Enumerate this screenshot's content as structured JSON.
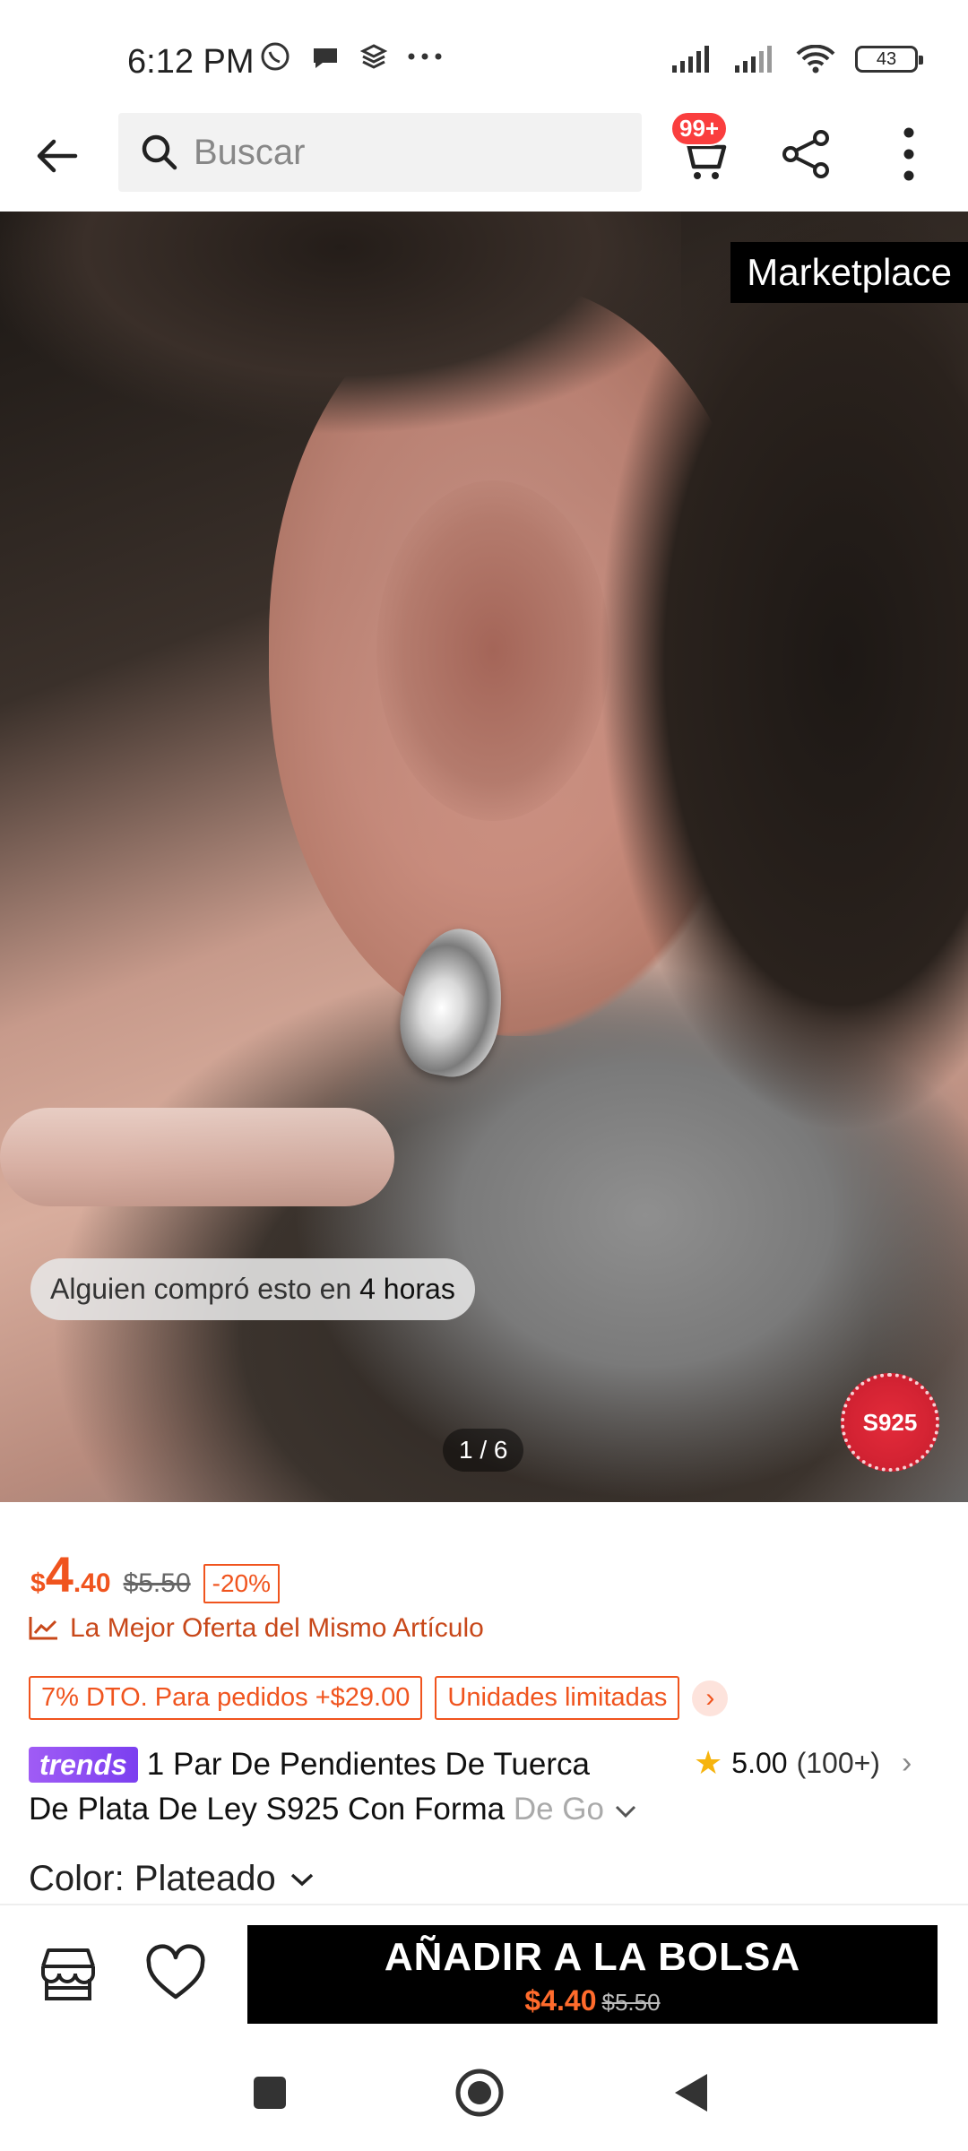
{
  "status_bar": {
    "time": "6:12 PM",
    "battery": "43",
    "icons": [
      "whatsapp-icon",
      "chat-icon",
      "layers-icon",
      "more-dots-icon",
      "signal-icon",
      "signal-icon",
      "wifi-icon",
      "battery-icon"
    ]
  },
  "header": {
    "search_placeholder": "Buscar",
    "cart_badge": "99+"
  },
  "hero": {
    "marketplace_label": "Marketplace",
    "recent_purchase_prefix": "Alguien compró esto en ",
    "recent_purchase_time": "4 horas",
    "pager": "1 / 6",
    "badge": "S925"
  },
  "product": {
    "currency": "$",
    "price_int": "4",
    "price_dec": ".40",
    "old_price": "$5.50",
    "discount": "-20%",
    "best_offer": "La Mejor Oferta del Mismo Artículo",
    "promo_tags": [
      "7% DTO. Para pedidos +$29.00",
      "Unidades limitadas"
    ],
    "brand_tag": "trends",
    "title_line1": "1 Par De Pendientes De Tuerca",
    "title_line2": "De Plata De Ley S925 Con Forma ",
    "title_fade": "De Go",
    "rating": "5.00",
    "rating_count": "(100+)",
    "color_label": "Color: Plateado"
  },
  "bottom_bar": {
    "add_label": "AÑADIR A LA BOLSA",
    "price": "$4.40",
    "old_price": "$5.50"
  },
  "colors": {
    "accent": "#f0541e",
    "badge": "#fa3e3e",
    "trends": "#8b4cf2",
    "star": "#f6b40e"
  }
}
